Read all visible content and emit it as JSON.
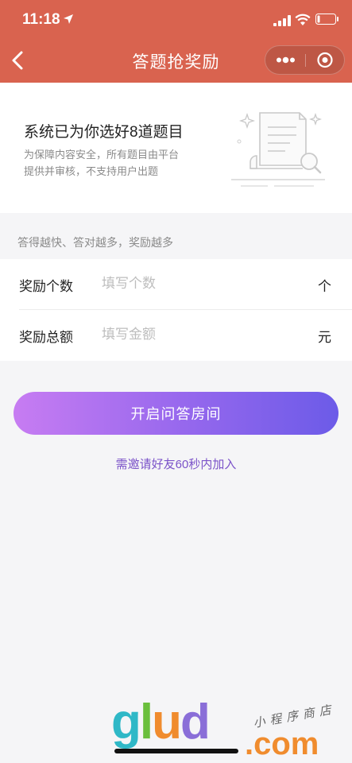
{
  "status_bar": {
    "time": "11:18"
  },
  "nav": {
    "title": "答题抢奖励"
  },
  "intro": {
    "title": "系统已为你选好8道题目",
    "desc_line1": "为保障内容安全，所有题目由平台",
    "desc_line2": "提供并审核，不支持用户出题"
  },
  "hint": "答得越快、答对越多，奖励越多",
  "form": {
    "count": {
      "label": "奖励个数",
      "placeholder": "填写个数",
      "unit": "个"
    },
    "amount": {
      "label": "奖励总额",
      "placeholder": "填写金额",
      "unit": "元"
    }
  },
  "start_button": "开启问答房间",
  "invite_note": "需邀请好友60秒内加入",
  "watermark": {
    "g": "g",
    "l": "l",
    "u": "u",
    "d": "d",
    "tag": "小程序商店",
    "domain": ".com"
  },
  "colors": {
    "header": "#d9634f",
    "gradient_start": "#c77cf2",
    "gradient_end": "#6c5be8",
    "invite_text": "#7b53c9"
  },
  "icons": [
    "location-arrow-icon",
    "signal-icon",
    "wifi-icon",
    "battery-icon",
    "back-chevron-icon",
    "more-dots-icon",
    "close-target-icon",
    "document-search-icon"
  ]
}
